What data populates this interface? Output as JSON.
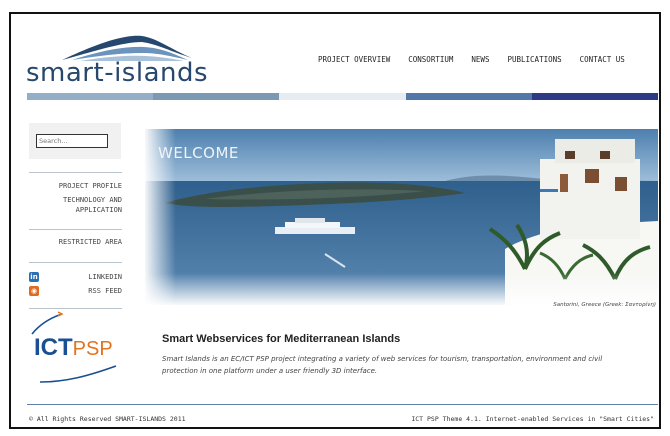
{
  "logo": {
    "text": "smart-islands"
  },
  "nav": {
    "items": [
      "PROJECT OVERVIEW",
      "CONSORTIUM",
      "NEWS",
      "PUBLICATIONS",
      "CONTACT US"
    ]
  },
  "colors": {
    "stripes": [
      "#94aec7",
      "#7c99b4",
      "#e7ecf2",
      "#5178a6",
      "#2d3a86"
    ]
  },
  "sidebar": {
    "search_placeholder": "Search...",
    "links": [
      "PROJECT PROFILE",
      "TECHNOLOGY AND",
      "APPLICATION",
      "RESTRICTED AREA"
    ],
    "social": [
      {
        "icon": "linkedin-icon",
        "label": "LINKEDIN"
      },
      {
        "icon": "rss-icon",
        "label": "RSS FEED"
      }
    ],
    "partner_logo": {
      "main": "ICT",
      "sub": "PSP"
    }
  },
  "hero": {
    "title": "WELCOME",
    "caption": "Santorini, Greece (Greek: Σαντορίνη)"
  },
  "main": {
    "headline": "Smart Webservices for Mediterranean Islands",
    "description": "Smart Islands is an EC/ICT PSP project integrating a variety of web services for tourism, transportation, environment and civil protection in one platform under a user friendly 3D interface."
  },
  "footer": {
    "left": "© All Rights Reserved SMART-ISLANDS  2011",
    "right": "ICT PSP Theme 4.1. Internet-enabled Services in \"Smart Cities\""
  }
}
